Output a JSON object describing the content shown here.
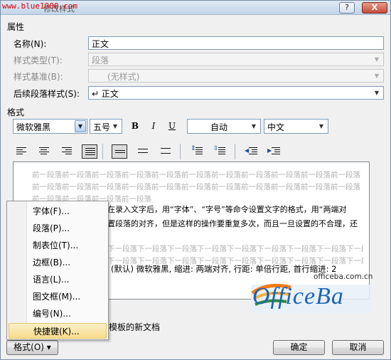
{
  "watermark_url": "www.blue1000.com",
  "window": {
    "title": "修改样式",
    "help_label": "?",
    "close_label": "X"
  },
  "properties": {
    "section": "属性",
    "name_label": "名称(N):",
    "name_value": "正文",
    "style_type_label": "样式类型(T):",
    "style_type_value": "段落",
    "style_based_label": "样式基准(B):",
    "style_based_value": "(无样式)",
    "next_style_label": "后续段落样式(S):",
    "next_style_value": "↵ 正文"
  },
  "format": {
    "section": "格式",
    "font": "微软雅黑",
    "size": "五号",
    "bold": "B",
    "italic": "I",
    "underline": "U",
    "color": "自动",
    "language": "中文"
  },
  "preview": {
    "prev_lines": [
      "前一段落前一段落前一段落前一段落前一段落前一段落前一段落前一段落前一段落前一段落前一段落",
      "前一段落前一段落前一段落前一段落前一段落前一段落前一段落前一段落前一段落前一段落前一段落",
      "前一段落前一段落前一段落前一段落"
    ],
    "body_lines": [
      "在录入文字后，用“字体”、“字号”等命令设置文字的格式，用“两端对",
      "置段落的对齐，但是这样的操作要重复多次，而且一旦设置的不合理，还"
    ],
    "next_lines": [
      "下一段落下一段落下一段落下一段落下一段落下一段落下一段落下一段落下一段落下一段落",
      "下一段落下一段落下一段落下一段落下一段落下一段落下一段落下一段落下一段落下一段落"
    ]
  },
  "description": "(默认) 微软雅黑, 缩进: 两端对齐, 行距: 单倍行距, 首行缩进: 2",
  "menu": {
    "items": [
      {
        "label": "字体(F)..."
      },
      {
        "label": "段落(P)..."
      },
      {
        "label": "制表位(T)..."
      },
      {
        "label": "边框(B)..."
      },
      {
        "label": "语言(L)..."
      },
      {
        "label": "图文框(M)..."
      },
      {
        "label": "编号(N)..."
      },
      {
        "label": "快捷键(K)..."
      }
    ]
  },
  "template_text": "模板的新文档",
  "footer": {
    "format_label": "格式(O) ▾",
    "ok_label": "确定",
    "cancel_label": "取消"
  },
  "logo": {
    "text": "OfficeBa",
    "sub": "officeba.com.cn"
  }
}
